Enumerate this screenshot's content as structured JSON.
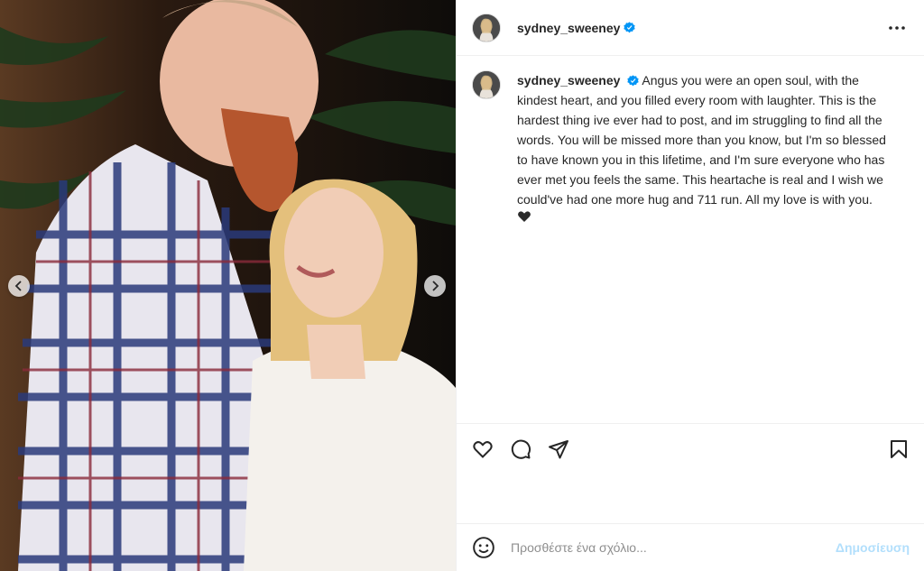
{
  "header": {
    "username": "sydney_sweeney",
    "verified_icon": "verified-badge-icon",
    "more_icon": "more-options-icon"
  },
  "caption": {
    "username": "sydney_sweeney",
    "text": "Angus you were an open soul, with the kindest heart, and you filled every room with laughter. This is the hardest thing ive ever had to post, and im struggling to find all the words. You will be missed more than you know, but I'm so blessed to have known you in this lifetime, and I'm sure everyone who has ever met you feels the same. This heartache is real and I wish we could've had one more hug and 711 run. All my love is with you.",
    "emoji": "black-heart-icon"
  },
  "actions": {
    "icons": [
      "like-heart-icon",
      "comment-icon",
      "share-icon",
      "save-bookmark-icon"
    ]
  },
  "comment": {
    "placeholder": "Προσθέστε ένα σχόλιο...",
    "post_label": "Δημοσίευση"
  },
  "colors": {
    "verified": "#0095f6",
    "post_button": "#b2dffc",
    "border": "#efefef"
  }
}
